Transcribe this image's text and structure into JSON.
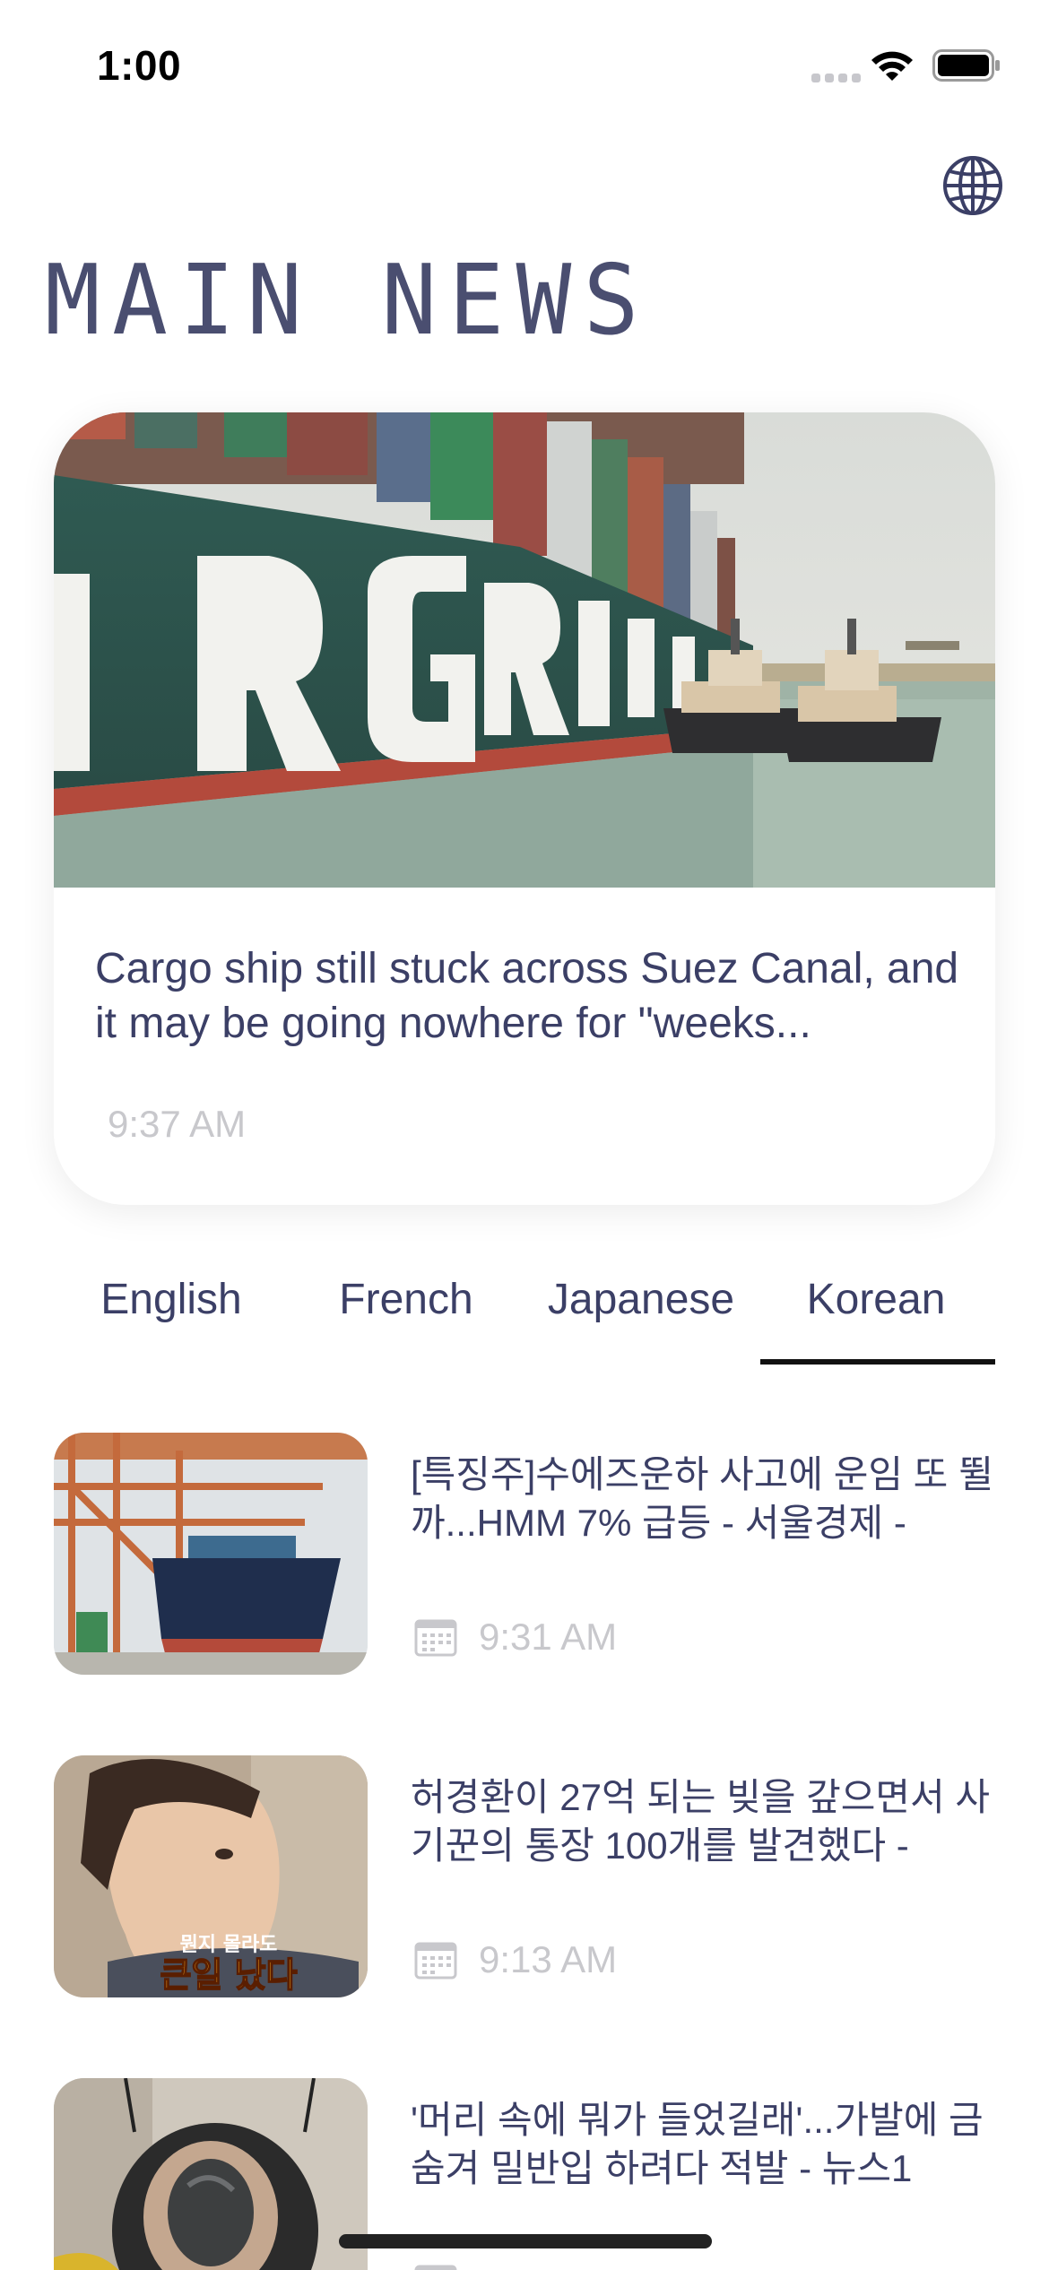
{
  "status_bar": {
    "time": "1:00"
  },
  "header": {
    "title": "MAIN NEWS",
    "language_icon": "globe-icon"
  },
  "featured": {
    "headline": "Cargo ship still stuck across Suez Canal, and it may be going nowhere for \"weeks...",
    "time": "9:37 AM",
    "image_text": "RGREEN"
  },
  "tabs": [
    {
      "label": "English",
      "selected": false
    },
    {
      "label": "French",
      "selected": false
    },
    {
      "label": "Japanese",
      "selected": false
    },
    {
      "label": "Korean",
      "selected": true
    }
  ],
  "news": [
    {
      "title": "[특징주]수에즈운하 사고에 운임 또 뛸까...HMM 7% 급등 - 서울경제 -",
      "time": "9:31 AM",
      "icon": "calendar-icon"
    },
    {
      "title": "허경환이 27억 되는 빚을 갚으면서 사기꾼의 통장 100개를 발견했다 -",
      "time": "9:13 AM",
      "icon": "calendar-icon",
      "thumb_caption_top": "뭔지 몰라도",
      "thumb_caption_bottom": "큰일 났다"
    },
    {
      "title": "'머리 속에 뭐가 들었길래'...가발에 금 숨겨 밀반입 하려다 적발 - 뉴스1",
      "time": "",
      "icon": "calendar-icon"
    }
  ],
  "colors": {
    "text_primary": "#3b3f66",
    "text_muted": "#c8c8cc",
    "tab_indicator": "#111111"
  }
}
